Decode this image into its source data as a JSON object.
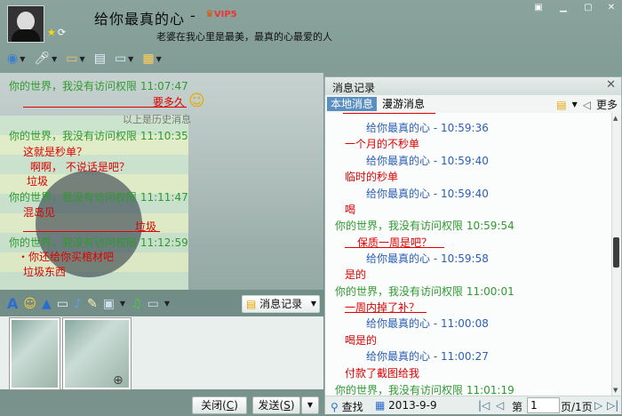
{
  "window": {
    "title": "给你最真的心",
    "title_sep": "-",
    "vip_label": "VIP5",
    "signature": "老婆在我心里是最美，最真的心最爱的人",
    "controls": [
      "▣",
      "▁",
      "▢",
      "✕"
    ]
  },
  "chat": {
    "lines": [
      {
        "text": "你的世界，我没有访问权限   11:07:47",
        "color": "green"
      },
      {
        "text": "要多久",
        "color": "red"
      },
      {
        "text": "以上是历史消息",
        "color": "gray"
      },
      {
        "text": "你的世界，我没有访问权限   11:10:35",
        "color": "green"
      },
      {
        "text": "这就是秒单？",
        "color": "red"
      },
      {
        "text": "啊啊，  不说话是吧？",
        "color": "red"
      },
      {
        "text": "垃圾",
        "color": "red"
      },
      {
        "text": "你的世界，我没有访问权限   11:11:47",
        "color": "green"
      },
      {
        "text": "混岛见",
        "color": "red"
      },
      {
        "text": "垃圾",
        "color": "red"
      },
      {
        "text": "你的世界，我没有访问权限   11:12:59",
        "color": "green"
      },
      {
        "text": "・你还给你买棺材吧",
        "color": "red"
      },
      {
        "text": "垃圾东西",
        "color": "red"
      }
    ]
  },
  "input_toolbar": {
    "message_record_label": "消息记录"
  },
  "buttons": {
    "close_label": "关闭(",
    "close_key": "C",
    "close_end": ")",
    "send_label": "发送(",
    "send_key": "S",
    "send_end": ")"
  },
  "history_panel": {
    "title": "消息记录",
    "tab_local": "本地消息",
    "tab_roam": "漫游消息",
    "more_label": "更多",
    "log": [
      {
        "text": "给你最真的心  - 10:59:36",
        "color": "blue",
        "indent": 1
      },
      {
        "text": "一个月的不秒单",
        "color": "red",
        "indent": 0
      },
      {
        "text": "给你最真的心  - 10:59:40",
        "color": "blue",
        "indent": 1
      },
      {
        "text": "临时的秒单",
        "color": "red",
        "indent": 0
      },
      {
        "text": "给你最真的心  - 10:59:40",
        "color": "blue",
        "indent": 1
      },
      {
        "text": "喝",
        "color": "red",
        "indent": 0
      },
      {
        "text": "你的世界，我没有访问权限 10:59:54",
        "color": "green",
        "indent": -1
      },
      {
        "text": "保质一周是吧？",
        "color": "red",
        "indent": 0
      },
      {
        "text": "给你最真的心  - 10:59:58",
        "color": "blue",
        "indent": 1
      },
      {
        "text": "是的",
        "color": "red",
        "indent": 0
      },
      {
        "text": "你的世界，我没有访问权限 11:00:01",
        "color": "green",
        "indent": -1
      },
      {
        "text": "一周内掉了补？",
        "color": "red",
        "indent": 0
      },
      {
        "text": "给你最真的心  - 11:00:08",
        "color": "blue",
        "indent": 1
      },
      {
        "text": "喝是的",
        "color": "red",
        "indent": 0
      },
      {
        "text": "给你最真的心  - 11:00:27",
        "color": "blue",
        "indent": 1
      },
      {
        "text": "付款了截图给我",
        "color": "red",
        "indent": 0
      },
      {
        "text": "你的世界，我没有访问权限 11:01:19",
        "color": "green",
        "indent": -1
      }
    ],
    "pager": {
      "search_label": "查找",
      "date": "2013-9-9",
      "page_prefix": "第",
      "page_value": "1",
      "page_suffix": "页/1页"
    }
  }
}
